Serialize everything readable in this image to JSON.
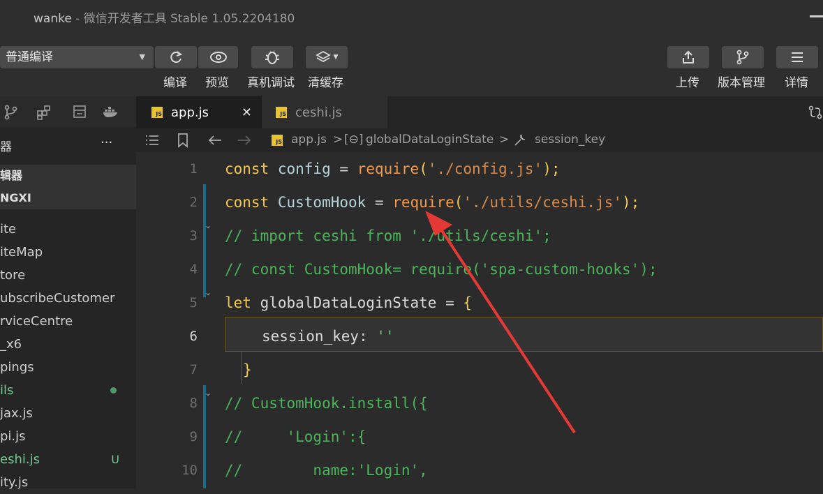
{
  "window": {
    "title_app": "wanke",
    "title_rest": " - 微信开发者工具 Stable 1.05.2204180"
  },
  "toolbar": {
    "compile_mode": "普通编译",
    "compile_label": "编译",
    "preview_label": "预览",
    "remote_debug_label": "真机调试",
    "clear_cache_label": "清缓存",
    "upload_label": "上传",
    "version_label": "版本管理",
    "details_label": "详情"
  },
  "sidebar": {
    "header": "器",
    "more": "···",
    "groups": [
      "辑器",
      "NGXI"
    ],
    "items": [
      {
        "label": "ite",
        "green": false
      },
      {
        "label": "iteMap",
        "green": false
      },
      {
        "label": "tore",
        "green": false
      },
      {
        "label": "ubscribeCustomer",
        "green": false
      },
      {
        "label": "rviceCentre",
        "green": false
      },
      {
        "label": "_x6",
        "green": false
      },
      {
        "label": "pings",
        "green": false
      },
      {
        "label": "ils",
        "green": true,
        "badge": "dot"
      },
      {
        "label": "jax.js",
        "green": false
      },
      {
        "label": "pi.js",
        "green": false
      },
      {
        "label": "eshi.js",
        "green": true,
        "badge": "U"
      },
      {
        "label": "ity.js",
        "green": false
      }
    ]
  },
  "tabs": [
    {
      "label": "app.js",
      "icon": "JS",
      "active": true,
      "close": "✕"
    },
    {
      "label": "ceshi.js",
      "icon": "JS",
      "active": false
    }
  ],
  "breadcrumb": {
    "file": "app.js",
    "symbol": "globalDataLoginState",
    "key": "session_key",
    "sep": ">"
  },
  "editor": {
    "line_numbers": [
      "1",
      "2",
      "3",
      "4",
      "5",
      "6",
      "7",
      "8",
      "9",
      "10"
    ],
    "l1": {
      "a": "const",
      "b": " config ",
      "c": "=",
      "d": " require",
      "e": "(",
      "f": "'./config.js'",
      "g": ");"
    },
    "l2": {
      "a": "const",
      "b": " CustomHook ",
      "c": "=",
      "d": " require",
      "e": "(",
      "f": "'./utils/ceshi.js'",
      "g": ");"
    },
    "l3": "// import ceshi from './utils/ceshi';",
    "l4": "// const CustomHook= require('spa-custom-hooks');",
    "l5": {
      "a": "let",
      "b": " globalDataLoginState ",
      "c": "=",
      "d": " {"
    },
    "l6": {
      "a": "session_key",
      "b": ": ",
      "c": "''"
    },
    "l7": "}",
    "l8": "// CustomHook.install({",
    "l9": "//     'Login':{",
    "l10": "//        name:'Login',"
  }
}
